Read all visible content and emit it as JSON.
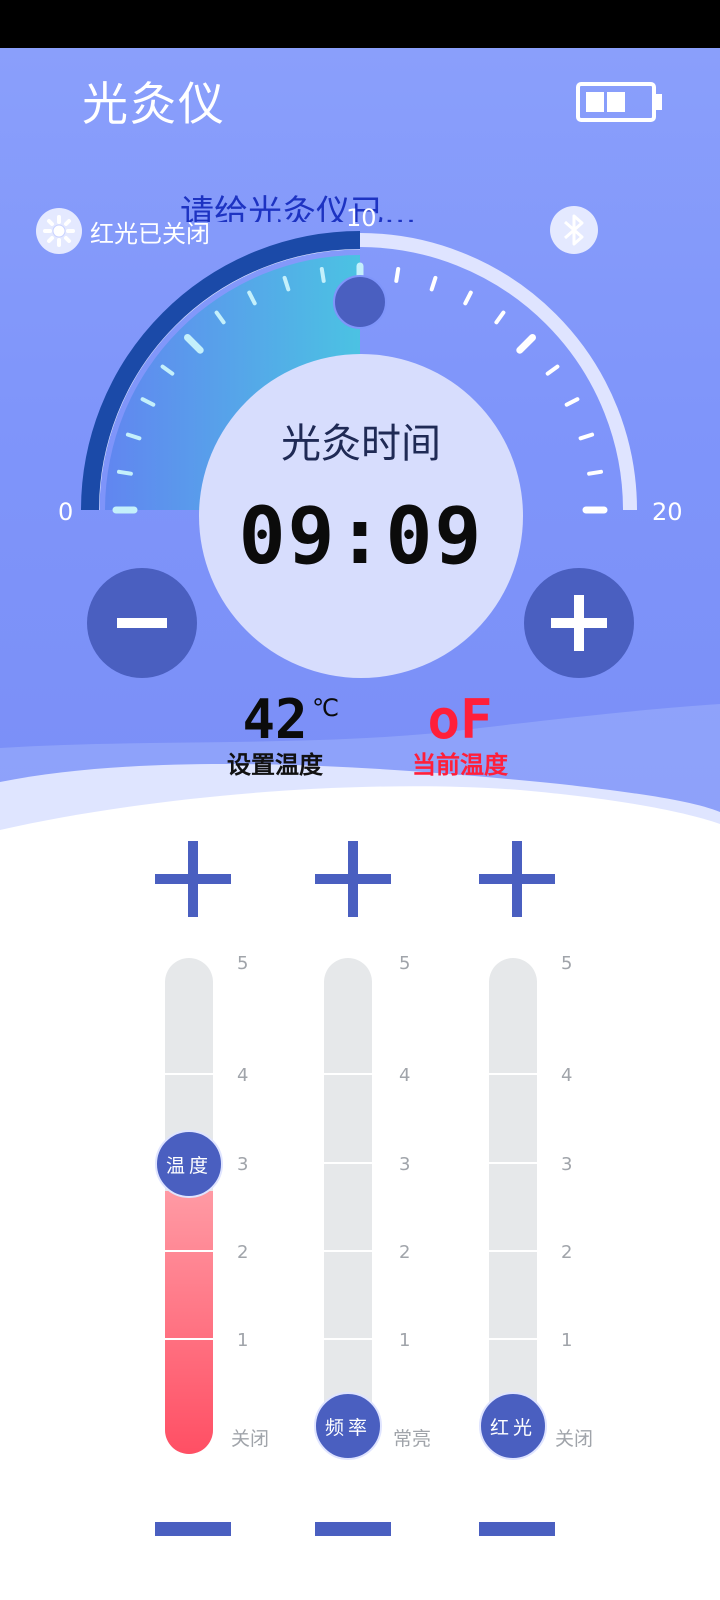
{
  "app": {
    "title": "光灸仪",
    "marquee_text": "请给光灸仪已...",
    "battery_level": 0.67
  },
  "status": {
    "red_light_label": "红光已关闭",
    "bluetooth_icon": "bluetooth-icon",
    "sun_icon": "sun-icon"
  },
  "gauge": {
    "min_label": "0",
    "mid_label": "10",
    "max_label": "20",
    "value": 10,
    "max": 20
  },
  "timer": {
    "title": "光灸时间",
    "value": "09:09"
  },
  "temperature": {
    "set_value": "42",
    "unit": "℃",
    "set_label": "设置温度",
    "current_value": "oF",
    "current_label": "当前温度"
  },
  "sliders": [
    {
      "knob_label": "温度",
      "levels": [
        "5",
        "4",
        "3",
        "2",
        "1"
      ],
      "bottom_label": "关闭",
      "value": 3
    },
    {
      "knob_label": "频率",
      "levels": [
        "5",
        "4",
        "3",
        "2",
        "1"
      ],
      "bottom_label": "常亮",
      "value": 0
    },
    {
      "knob_label": "红光",
      "levels": [
        "5",
        "4",
        "3",
        "2",
        "1"
      ],
      "bottom_label": "关闭",
      "value": 0
    }
  ],
  "colors": {
    "accent": "#4a5fc0",
    "hero_bg": "#8a9ffb",
    "alert_red": "#ff1f3a",
    "slider_fill_red": "#ff4f64"
  }
}
